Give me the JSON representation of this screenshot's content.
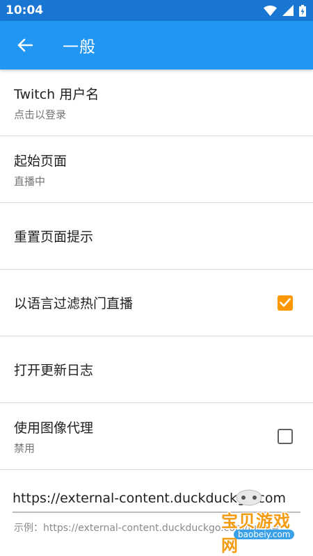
{
  "status_bar": {
    "time": "10:04"
  },
  "app_bar": {
    "title": "一般"
  },
  "settings": [
    {
      "title": "Twitch 用户名",
      "subtitle": "点击以登录"
    },
    {
      "title": "起始页面",
      "subtitle": "直播中"
    },
    {
      "title": "重置页面提示"
    },
    {
      "title": "以语言过滤热门直播",
      "checked": true
    },
    {
      "title": "打开更新日志"
    },
    {
      "title": "使用图像代理",
      "subtitle": "禁用",
      "checked": false
    }
  ],
  "proxy_url": {
    "value": "https://external-content.duckduckgo.com",
    "hint": "示例：https://external-content.duckduckgo.com/iu/?u="
  },
  "watermark": {
    "text": "宝贝游戏网",
    "site": "baobeiy.com"
  },
  "colors": {
    "status_bar": "#1976d2",
    "app_bar": "#2196f3",
    "checkbox_checked": "#ff9800"
  },
  "icons": {
    "back": "arrow-left-icon",
    "wifi": "wifi-icon",
    "signal": "signal-icon",
    "battery": "battery-charging-icon"
  }
}
